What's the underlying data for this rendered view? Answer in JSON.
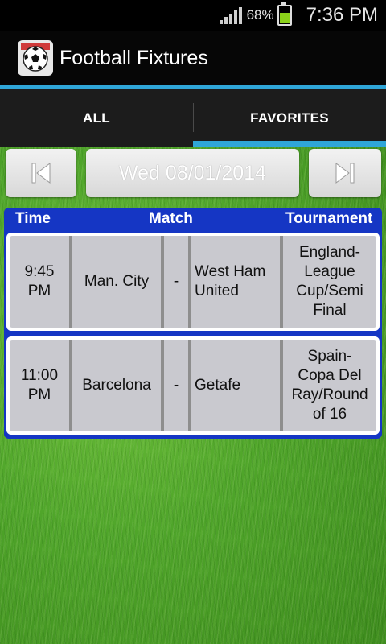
{
  "status_bar": {
    "battery_percent": "68%",
    "time": "7:36 PM"
  },
  "app": {
    "title": "Football Fixtures"
  },
  "tabs": [
    {
      "label": "ALL",
      "active": false
    },
    {
      "label": "FAVORITES",
      "active": true
    }
  ],
  "date_nav": {
    "date": "Wed 08/01/2014"
  },
  "table": {
    "headers": {
      "time": "Time",
      "match": "Match",
      "tournament": "Tournament"
    },
    "rows": [
      {
        "time": "9:45\nPM",
        "home": "Man. City",
        "sep": "-",
        "away": "West Ham\nUnited",
        "tournament": "England-\nLeague\nCup/Semi\nFinal"
      },
      {
        "time": "11:00\nPM",
        "home": "Barcelona",
        "sep": "-",
        "away": "Getafe",
        "tournament": "Spain-\nCopa Del\nRay/Round\nof 16"
      }
    ]
  },
  "colors": {
    "accent": "#2fa6d8",
    "table_blue": "#1536c4",
    "grass": "#4fa52a"
  }
}
